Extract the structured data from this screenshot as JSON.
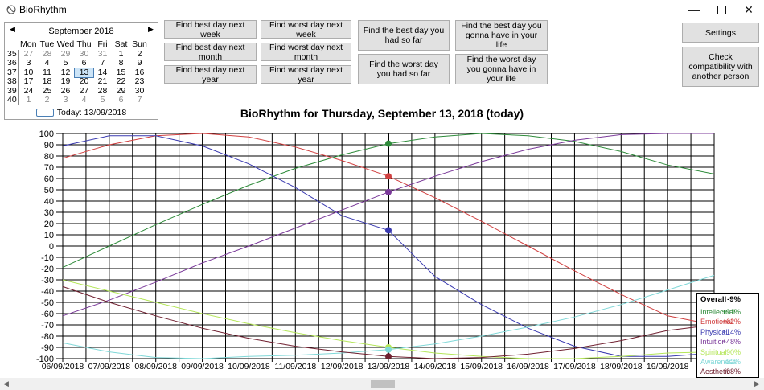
{
  "window": {
    "title": "BioRhythm",
    "minimize_icon": "minimize-icon",
    "maximize_icon": "maximize-icon",
    "close_icon": "close-icon"
  },
  "calendar": {
    "month": "September 2018",
    "days_header": [
      "Mon",
      "Tue",
      "Wed",
      "Thu",
      "Fri",
      "Sat",
      "Sun"
    ],
    "weeks": [
      {
        "wk": "35",
        "days": [
          "27",
          "28",
          "29",
          "30",
          "31",
          "1",
          "2"
        ]
      },
      {
        "wk": "36",
        "days": [
          "3",
          "4",
          "5",
          "6",
          "7",
          "8",
          "9"
        ]
      },
      {
        "wk": "37",
        "days": [
          "10",
          "11",
          "12",
          "13",
          "14",
          "15",
          "16"
        ]
      },
      {
        "wk": "38",
        "days": [
          "17",
          "18",
          "19",
          "20",
          "21",
          "22",
          "23"
        ]
      },
      {
        "wk": "39",
        "days": [
          "24",
          "25",
          "26",
          "27",
          "28",
          "29",
          "30"
        ]
      },
      {
        "wk": "40",
        "days": [
          "1",
          "2",
          "3",
          "4",
          "5",
          "6",
          "7"
        ]
      }
    ],
    "selected": "13",
    "today_label": "Today: 13/09/2018"
  },
  "buttons": {
    "best_next_week": "Find best day next week",
    "best_next_month": "Find best day next month",
    "best_next_year": "Find best day next year",
    "worst_next_week": "Find worst day next week",
    "worst_next_month": "Find worst day next month",
    "worst_next_year": "Find worst day next year",
    "best_so_far": "Find the best day you had so far",
    "worst_so_far": "Find the worst day you had so far",
    "best_life": "Find the best day you gonna have in your life",
    "worst_life": "Find the worst day you gonna have in your life",
    "settings": "Settings",
    "compatibility": "Check compatibility with another person"
  },
  "chart_title": "BioRhythm for Thursday, September 13, 2018 (today)",
  "chart_data": {
    "type": "line",
    "x": [
      "06/09/2018",
      "07/09/2018",
      "08/09/2018",
      "09/09/2018",
      "10/09/2018",
      "11/09/2018",
      "12/09/2018",
      "13/09/2018",
      "14/09/2018",
      "15/09/2018",
      "16/09/2018",
      "17/09/2018",
      "18/09/2018",
      "19/09/2018"
    ],
    "ylim": [
      -100,
      100
    ],
    "yticks": [
      100,
      90,
      80,
      70,
      60,
      50,
      40,
      30,
      20,
      10,
      0,
      -10,
      -20,
      -30,
      -40,
      -50,
      -60,
      -70,
      -80,
      -90,
      -100
    ],
    "grid": true,
    "marker_date": "13/09/2018",
    "series": [
      {
        "name": "Intellectual",
        "color": "#2e8b3a",
        "values": [
          -19,
          0,
          19,
          37,
          54,
          69,
          81,
          91,
          97,
          100,
          98,
          93,
          84,
          72,
          64
        ]
      },
      {
        "name": "Emotional",
        "color": "#d04040",
        "values": [
          78,
          90,
          98,
          100,
          97,
          88,
          76,
          62,
          43,
          22,
          0,
          -22,
          -43,
          -62,
          -70
        ]
      },
      {
        "name": "Physical",
        "color": "#3a3ab0",
        "values": [
          89,
          98,
          98,
          89,
          73,
          52,
          27,
          14,
          -27,
          -52,
          -73,
          -89,
          -98,
          -98,
          -95
        ]
      },
      {
        "name": "Intuition",
        "color": "#7b3a9a",
        "values": [
          -62,
          -48,
          -32,
          -15,
          0,
          16,
          32,
          48,
          62,
          75,
          86,
          94,
          99,
          100,
          100
        ]
      },
      {
        "name": "Spiritual",
        "color": "#b5e65a",
        "values": [
          -30,
          -40,
          -50,
          -60,
          -69,
          -77,
          -84,
          -90,
          -95,
          -98,
          -100,
          -100,
          -98,
          -95,
          -94
        ]
      },
      {
        "name": "Awareness",
        "color": "#80d8d8",
        "values": [
          -86,
          -94,
          -99,
          -100,
          -98,
          -97,
          -95,
          -92,
          -87,
          -80,
          -72,
          -63,
          -52,
          -39,
          -26
        ]
      },
      {
        "name": "Aesthetic",
        "color": "#702030",
        "values": [
          -36,
          -50,
          -62,
          -73,
          -82,
          -89,
          -94,
          -98,
          -100,
          -99,
          -96,
          -91,
          -84,
          -75,
          -70
        ]
      }
    ]
  },
  "legend": {
    "overall_label": "Overall",
    "overall_value": "-9%",
    "items": [
      {
        "name": "Intellectual",
        "value": "+91%",
        "color": "#2e8b3a"
      },
      {
        "name": "Emotional",
        "value": "+62%",
        "color": "#d04040"
      },
      {
        "name": "Physical",
        "value": "+14%",
        "color": "#3a3ab0"
      },
      {
        "name": "Intuition",
        "value": "+48%",
        "color": "#7b3a9a"
      },
      {
        "name": "Spiritual",
        "value": "-90%",
        "color": "#b5e65a"
      },
      {
        "name": "Awareness",
        "value": "-92%",
        "color": "#80d8d8"
      },
      {
        "name": "Aesthetic",
        "value": "-98%",
        "color": "#702030"
      }
    ]
  }
}
